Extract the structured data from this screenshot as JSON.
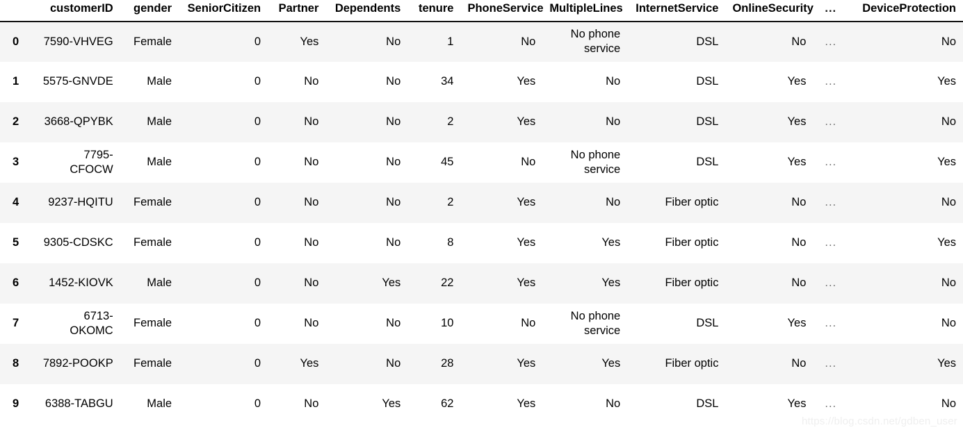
{
  "table": {
    "index_header": "",
    "columns": [
      "customerID",
      "gender",
      "SeniorCitizen",
      "Partner",
      "Dependents",
      "tenure",
      "PhoneService",
      "MultipleLines",
      "InternetService",
      "OnlineSecurity",
      "...",
      "DeviceProtection"
    ],
    "row_indices": [
      "0",
      "1",
      "2",
      "3",
      "4",
      "5",
      "6",
      "7",
      "8",
      "9"
    ],
    "rows": [
      {
        "index": "0",
        "customerID": "7590-VHVEG",
        "gender": "Female",
        "SeniorCitizen": "0",
        "Partner": "Yes",
        "Dependents": "No",
        "tenure": "1",
        "PhoneService": "No",
        "MultipleLines": "No phone service",
        "InternetService": "DSL",
        "OnlineSecurity": "No",
        "ellipsis": "...",
        "DeviceProtection": "No"
      },
      {
        "index": "1",
        "customerID": "5575-GNVDE",
        "gender": "Male",
        "SeniorCitizen": "0",
        "Partner": "No",
        "Dependents": "No",
        "tenure": "34",
        "PhoneService": "Yes",
        "MultipleLines": "No",
        "InternetService": "DSL",
        "OnlineSecurity": "Yes",
        "ellipsis": "...",
        "DeviceProtection": "Yes"
      },
      {
        "index": "2",
        "customerID": "3668-QPYBK",
        "gender": "Male",
        "SeniorCitizen": "0",
        "Partner": "No",
        "Dependents": "No",
        "tenure": "2",
        "PhoneService": "Yes",
        "MultipleLines": "No",
        "InternetService": "DSL",
        "OnlineSecurity": "Yes",
        "ellipsis": "...",
        "DeviceProtection": "No"
      },
      {
        "index": "3",
        "customerID": "7795-CFOCW",
        "gender": "Male",
        "SeniorCitizen": "0",
        "Partner": "No",
        "Dependents": "No",
        "tenure": "45",
        "PhoneService": "No",
        "MultipleLines": "No phone service",
        "InternetService": "DSL",
        "OnlineSecurity": "Yes",
        "ellipsis": "...",
        "DeviceProtection": "Yes"
      },
      {
        "index": "4",
        "customerID": "9237-HQITU",
        "gender": "Female",
        "SeniorCitizen": "0",
        "Partner": "No",
        "Dependents": "No",
        "tenure": "2",
        "PhoneService": "Yes",
        "MultipleLines": "No",
        "InternetService": "Fiber optic",
        "OnlineSecurity": "No",
        "ellipsis": "...",
        "DeviceProtection": "No"
      },
      {
        "index": "5",
        "customerID": "9305-CDSKC",
        "gender": "Female",
        "SeniorCitizen": "0",
        "Partner": "No",
        "Dependents": "No",
        "tenure": "8",
        "PhoneService": "Yes",
        "MultipleLines": "Yes",
        "InternetService": "Fiber optic",
        "OnlineSecurity": "No",
        "ellipsis": "...",
        "DeviceProtection": "Yes"
      },
      {
        "index": "6",
        "customerID": "1452-KIOVK",
        "gender": "Male",
        "SeniorCitizen": "0",
        "Partner": "No",
        "Dependents": "Yes",
        "tenure": "22",
        "PhoneService": "Yes",
        "MultipleLines": "Yes",
        "InternetService": "Fiber optic",
        "OnlineSecurity": "No",
        "ellipsis": "...",
        "DeviceProtection": "No"
      },
      {
        "index": "7",
        "customerID": "6713-OKOMC",
        "gender": "Female",
        "SeniorCitizen": "0",
        "Partner": "No",
        "Dependents": "No",
        "tenure": "10",
        "PhoneService": "No",
        "MultipleLines": "No phone service",
        "InternetService": "DSL",
        "OnlineSecurity": "Yes",
        "ellipsis": "...",
        "DeviceProtection": "No"
      },
      {
        "index": "8",
        "customerID": "7892-POOKP",
        "gender": "Female",
        "SeniorCitizen": "0",
        "Partner": "Yes",
        "Dependents": "No",
        "tenure": "28",
        "PhoneService": "Yes",
        "MultipleLines": "Yes",
        "InternetService": "Fiber optic",
        "OnlineSecurity": "No",
        "ellipsis": "...",
        "DeviceProtection": "Yes"
      },
      {
        "index": "9",
        "customerID": "6388-TABGU",
        "gender": "Male",
        "SeniorCitizen": "0",
        "Partner": "No",
        "Dependents": "Yes",
        "tenure": "62",
        "PhoneService": "Yes",
        "MultipleLines": "No",
        "InternetService": "DSL",
        "OnlineSecurity": "Yes",
        "ellipsis": "...",
        "DeviceProtection": "No"
      }
    ]
  },
  "watermark": {
    "text": "https://blog.csdn.net/gdben_user"
  },
  "colors": {
    "stripe": "#f5f5f5",
    "background": "#ffffff",
    "text": "#000000",
    "header_rule": "#111111",
    "watermark": "#efefef"
  }
}
